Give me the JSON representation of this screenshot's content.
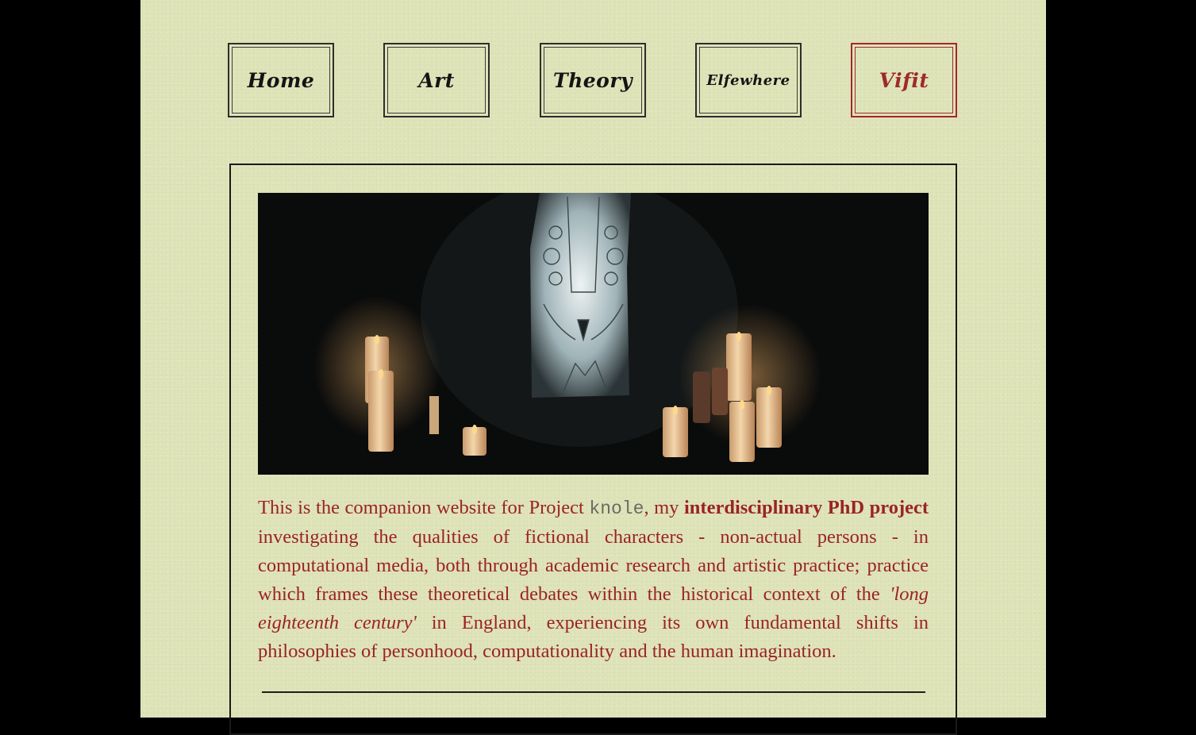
{
  "nav": [
    {
      "label": "Home",
      "active": false
    },
    {
      "label": "Art",
      "active": false
    },
    {
      "label": "Theory",
      "active": false
    },
    {
      "label": "Elfewhere",
      "active": false
    },
    {
      "label": "Vifit",
      "active": true
    }
  ],
  "intro": {
    "lead": "This is the companion website for Project ",
    "project_name": "knole",
    "after_name": ", my ",
    "bold": "interdisciplinary PhD project",
    "middle": " investigating the qualities of fictional characters - non-actual persons - in computational media, both through academic research and artistic practice; practice which frames these theoretical debates within the historical context of the ",
    "italic": "'long eighteenth century'",
    "tail": " in England, experiencing its own fundamental shifts in philosophies of personhood, computationality and the human imagination."
  },
  "colors": {
    "paper": "#dfe3b8",
    "accent_red": "#9e2a2a",
    "ink": "#141414",
    "outer": "#000000"
  }
}
